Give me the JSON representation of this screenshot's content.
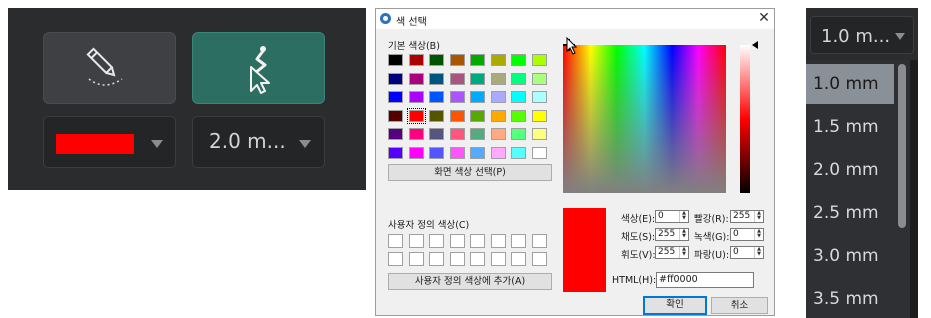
{
  "toolbar": {
    "pen_tool": {
      "icon": "pencil-icon",
      "selected": false
    },
    "laser_tool": {
      "icon": "laser-pointer-icon",
      "selected": true
    },
    "color_dropdown": {
      "current_color": "#ff0000"
    },
    "width_dropdown": {
      "label": "2.0 m..."
    }
  },
  "color_dialog": {
    "title": "색 선택",
    "basic_colors_label": "기본 색상(B)",
    "basic_colors": [
      "#000000",
      "#aa0000",
      "#005500",
      "#aa5500",
      "#00aa00",
      "#aaaa00",
      "#00ff00",
      "#aaff00",
      "#00007f",
      "#aa007f",
      "#00557f",
      "#aa557f",
      "#00aa7f",
      "#aaaa7f",
      "#00ff7f",
      "#aaff7f",
      "#0000ff",
      "#aa00ff",
      "#0055ff",
      "#aa55ff",
      "#00aaff",
      "#aaaaff",
      "#00ffff",
      "#aaffff",
      "#550000",
      "#ff0000",
      "#555500",
      "#ff5500",
      "#55aa00",
      "#ffaa00",
      "#55ff00",
      "#ffff00",
      "#55007f",
      "#ff007f",
      "#55557f",
      "#ff557f",
      "#55aa7f",
      "#ffaa7f",
      "#55ff7f",
      "#ffff7f",
      "#5500ff",
      "#ff00ff",
      "#5555ff",
      "#ff55ff",
      "#55aaff",
      "#ffaaff",
      "#55ffff",
      "#ffffff"
    ],
    "selected_basic_index": 25,
    "pick_screen_button": "화면 색상 선택(P)",
    "custom_colors_label": "사용자 정의 색상(C)",
    "add_custom_button": "사용자 정의 색상에 추가(A)",
    "fields": {
      "hue": {
        "label": "색상(E):",
        "value": "0"
      },
      "sat": {
        "label": "채도(S):",
        "value": "255"
      },
      "val": {
        "label": "휘도(V):",
        "value": "255"
      },
      "red": {
        "label": "빨강(R):",
        "value": "255"
      },
      "green": {
        "label": "녹색(G):",
        "value": "0"
      },
      "blue": {
        "label": "파랑(U):",
        "value": "0"
      }
    },
    "html_label": "HTML(H):",
    "html_value": "#ff0000",
    "ok": "확인",
    "cancel": "취소",
    "preview_color": "#ff0000"
  },
  "width_list": {
    "current": "1.0 m...",
    "options": [
      "1.0 mm",
      "1.5 mm",
      "2.0 mm",
      "2.5 mm",
      "3.0 mm",
      "3.5 mm"
    ],
    "selected_index": 0
  }
}
